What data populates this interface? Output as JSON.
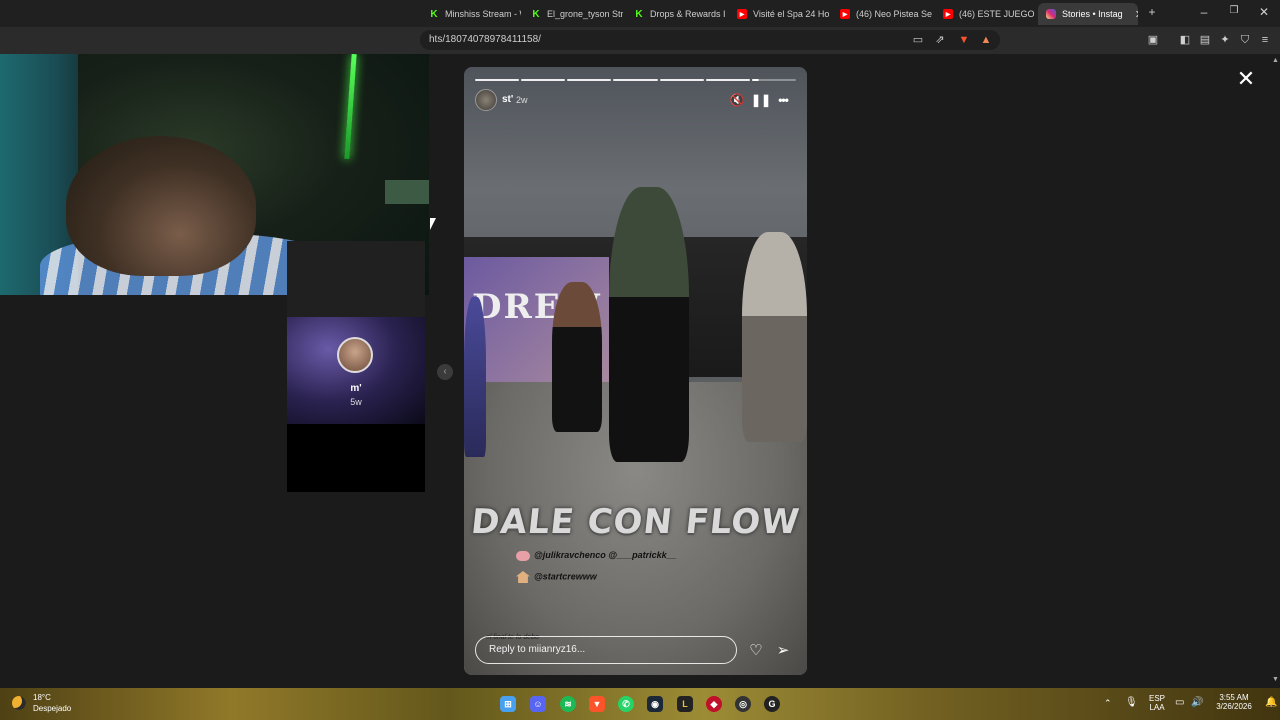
{
  "browser": {
    "tabs": [
      {
        "label": "Minshiss Stream - W",
        "icon": "kick-icon",
        "color": "#53fc18"
      },
      {
        "label": "El_grone_tyson Stre",
        "icon": "kick-icon",
        "color": "#53fc18"
      },
      {
        "label": "Drops & Rewards In",
        "icon": "kick-icon",
        "color": "#53fc18"
      },
      {
        "label": "Visité el Spa 24 Hor",
        "icon": "youtube-icon",
        "color": "#ff0000"
      },
      {
        "label": "(46) Neo Pistea Se l",
        "icon": "youtube-icon",
        "color": "#ff0000"
      },
      {
        "label": "(46) ESTE JUEGO DE",
        "icon": "youtube-icon",
        "color": "#ff0000"
      },
      {
        "label": "Stories • Instag",
        "icon": "instagram-icon",
        "color": "#e1306c",
        "active": true
      }
    ],
    "new_tab": "+",
    "url": "hts/18074078978411158/"
  },
  "side_story": {
    "username": "m'",
    "time": "5w"
  },
  "story": {
    "username": "st'",
    "time": "2w",
    "progress_segments": 7,
    "progress_current_fraction": 0.15,
    "caption": "DALE CON FLOW",
    "mention_1": "@julikravchenco @___patrickk__",
    "mention_2": "@startcrewww",
    "small_text": "el final te lo debo",
    "reply_placeholder": "Reply to miianryz16...",
    "banner_text": "DREW"
  },
  "taskbar": {
    "weather_temp": "18°C",
    "weather_desc": "Despejado",
    "lang_1": "ESP",
    "lang_2": "LAA",
    "time": "3:55 AM",
    "date": "3/26/2026"
  },
  "colors": {
    "accent_kick": "#53fc18",
    "accent_youtube": "#ff0000",
    "accent_instagram": "#e1306c"
  }
}
